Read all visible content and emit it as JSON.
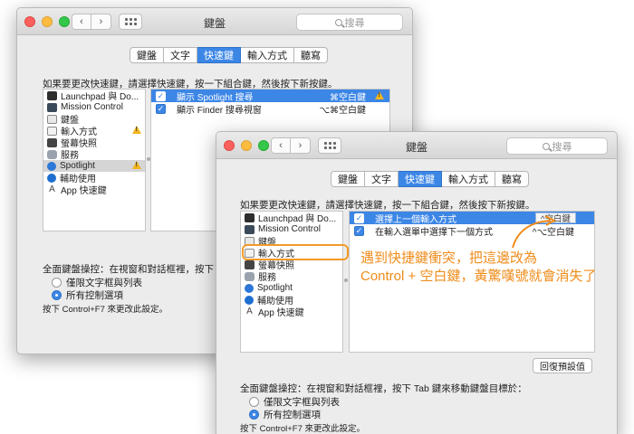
{
  "colors": {
    "accent": "#3c86e6",
    "annotation": "#ef8c1a",
    "warning": "#f2b51c"
  },
  "back_window": {
    "title": "鍵盤",
    "search_placeholder": "搜尋",
    "tabs": [
      {
        "label": "鍵盤",
        "active": false
      },
      {
        "label": "文字",
        "active": false
      },
      {
        "label": "快速鍵",
        "active": true
      },
      {
        "label": "輸入方式",
        "active": false
      },
      {
        "label": "聽寫",
        "active": false
      }
    ],
    "hint": "如果要更改快速鍵，請選擇快速鍵，按一下組合鍵，然後按下新按鍵。",
    "categories": [
      {
        "label": "Launchpad 與 Do...",
        "icon": "launchpad-icon"
      },
      {
        "label": "Mission Control",
        "icon": "mission-control-icon"
      },
      {
        "label": "鍵盤",
        "icon": "keyboard-icon"
      },
      {
        "label": "輸入方式",
        "icon": "input-source-icon",
        "warning": true
      },
      {
        "label": "螢幕快照",
        "icon": "screenshot-icon"
      },
      {
        "label": "服務",
        "icon": "services-icon"
      },
      {
        "label": "Spotlight",
        "icon": "spotlight-icon",
        "warning": true,
        "selected": true
      },
      {
        "label": "輔助使用",
        "icon": "accessibility-icon"
      },
      {
        "label": "App 快速鍵",
        "icon": "app-shortcuts-icon"
      }
    ],
    "shortcuts": [
      {
        "label": "顯示 Spotlight 搜尋",
        "key": "⌘空白鍵",
        "checked": true,
        "selected": true,
        "warning": true
      },
      {
        "label": "顯示 Finder 搜尋視窗",
        "key": "⌥⌘空白鍵",
        "checked": true,
        "selected": false
      }
    ],
    "full_keyboard_access": "全面鍵盤操控：在視窗和對話框裡，按下 Tab 鍵來",
    "radios": [
      {
        "label": "僅限文字框與列表",
        "on": false
      },
      {
        "label": "所有控制選項",
        "on": true
      }
    ],
    "footnote": "按下 Control+F7 來更改此設定。"
  },
  "front_window": {
    "title": "鍵盤",
    "search_placeholder": "搜尋",
    "tabs": [
      {
        "label": "鍵盤",
        "active": false
      },
      {
        "label": "文字",
        "active": false
      },
      {
        "label": "快速鍵",
        "active": true
      },
      {
        "label": "輸入方式",
        "active": false
      },
      {
        "label": "聽寫",
        "active": false
      }
    ],
    "hint": "如果要更改快速鍵，請選擇快速鍵，按一下組合鍵，然後按下新按鍵。",
    "categories": [
      {
        "label": "Launchpad 與 Do...",
        "icon": "launchpad-icon"
      },
      {
        "label": "Mission Control",
        "icon": "mission-control-icon"
      },
      {
        "label": "鍵盤",
        "icon": "keyboard-icon"
      },
      {
        "label": "輸入方式",
        "icon": "input-source-icon",
        "highlighted": true
      },
      {
        "label": "螢幕快照",
        "icon": "screenshot-icon"
      },
      {
        "label": "服務",
        "icon": "services-icon"
      },
      {
        "label": "Spotlight",
        "icon": "spotlight-icon"
      },
      {
        "label": "輔助使用",
        "icon": "accessibility-icon"
      },
      {
        "label": "App 快速鍵",
        "icon": "app-shortcuts-icon"
      }
    ],
    "shortcuts": [
      {
        "label": "選擇上一個輸入方式",
        "key": "^空白鍵",
        "checked": true,
        "selected": true,
        "editing": true
      },
      {
        "label": "在輸入選單中選擇下一個方式",
        "key": "^⌥空白鍵",
        "checked": true,
        "selected": false
      }
    ],
    "restore_button": "回復預設值",
    "full_keyboard_access": "全面鍵盤操控：在視窗和對話框裡，按下 Tab 鍵來移動鍵盤目標於：",
    "radios": [
      {
        "label": "僅限文字框與列表",
        "on": false
      },
      {
        "label": "所有控制選項",
        "on": true
      }
    ],
    "footnote": "按下 Control+F7 來更改此設定。"
  },
  "annotation": {
    "line1": "遇到快捷鍵衝突，把這邊改為",
    "line2": "Control + 空白鍵，黃驚嘆號就會消失了"
  }
}
